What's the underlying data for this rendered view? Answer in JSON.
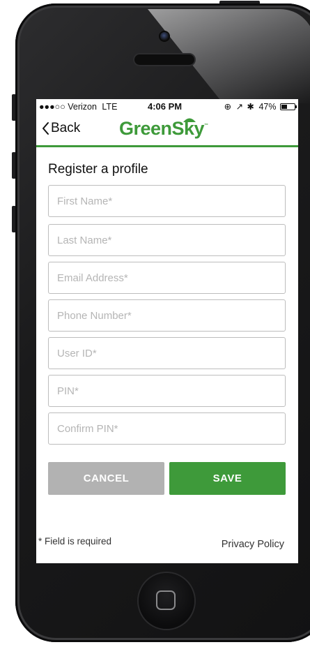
{
  "status_bar": {
    "carrier": "●●●○○ Verizon",
    "network": "LTE",
    "time": "4:06 PM",
    "battery": "47%",
    "battery_level": 0.47
  },
  "nav": {
    "back_label": "Back",
    "logo_text": "GreenSky",
    "logo_tm": "™"
  },
  "form": {
    "title": "Register a profile",
    "fields": [
      {
        "placeholder": "First Name*",
        "value": ""
      },
      {
        "placeholder": "Last Name*",
        "value": ""
      },
      {
        "placeholder": "Email Address*",
        "value": ""
      },
      {
        "placeholder": "Phone Number*",
        "value": ""
      },
      {
        "placeholder": "User ID*",
        "value": ""
      },
      {
        "placeholder": "PIN*",
        "value": ""
      },
      {
        "placeholder": "Confirm PIN*",
        "value": ""
      }
    ],
    "cancel_label": "CANCEL",
    "save_label": "SAVE"
  },
  "footer": {
    "required_note": "* Field is required",
    "privacy_label": "Privacy Policy"
  },
  "colors": {
    "brand_green": "#3e9a3a",
    "cancel_gray": "#b2b2b2"
  }
}
